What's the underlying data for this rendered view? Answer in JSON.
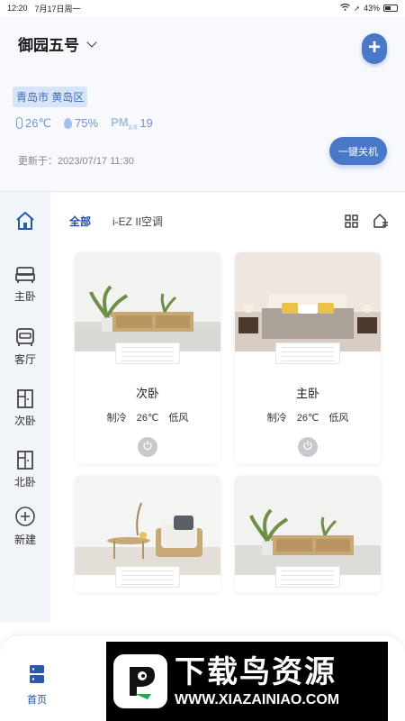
{
  "status_bar": {
    "time": "12:20",
    "date": "7月17日周一",
    "battery": "43%"
  },
  "header": {
    "home_name": "御园五号",
    "location": "青岛市 黄岛区",
    "temperature": "26℃",
    "humidity": "75%",
    "pm_label": "PM",
    "pm_sub": "2.5",
    "pm_value": "19",
    "updated": "更新于：2023/07/17 11:30",
    "one_key_off": "一键关机"
  },
  "sidebar": {
    "items": [
      {
        "label": "主卧",
        "icon": "bed-icon"
      },
      {
        "label": "客厅",
        "icon": "sofa-icon"
      },
      {
        "label": "次卧",
        "icon": "door-icon"
      },
      {
        "label": "北卧",
        "icon": "door-icon"
      },
      {
        "label": "新建",
        "icon": "add-circle-icon"
      }
    ]
  },
  "tabs": {
    "all": "全部",
    "device": "i-EZ II空调"
  },
  "cards": [
    {
      "name": "次卧",
      "mode": "制冷",
      "temp": "26℃",
      "fan": "低风"
    },
    {
      "name": "主卧",
      "mode": "制冷",
      "temp": "26℃",
      "fan": "低风"
    },
    {
      "name": "",
      "mode": "",
      "temp": "",
      "fan": ""
    },
    {
      "name": "",
      "mode": "",
      "temp": "",
      "fan": ""
    }
  ],
  "bottom_nav": {
    "home": "首页"
  },
  "watermark": {
    "brand": "下载鸟资源",
    "url": "WWW.XIAZAINIAO.COM"
  },
  "colors": {
    "accent": "#4a78c8",
    "active_text": "#1f4f9c",
    "sidebar_bg": "#f1f4f9"
  }
}
